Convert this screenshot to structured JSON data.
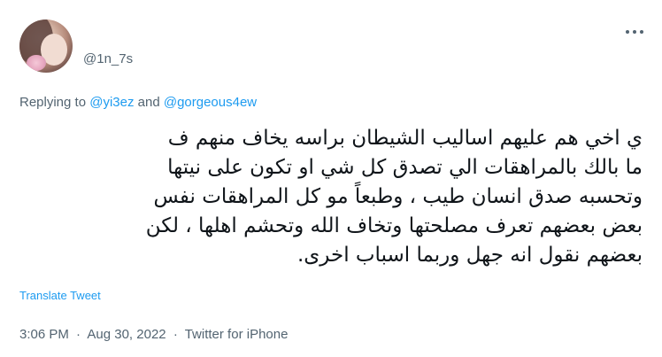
{
  "author": {
    "handle": "@1n_7s"
  },
  "reply_context": {
    "prefix": "Replying to",
    "user1": "@yi3ez",
    "conjunction": "and",
    "user2": "@gorgeous4ew"
  },
  "tweet": {
    "lines": [
      "ي اخي هم عليهم اساليب الشيطان براسه يخاف منهم ف",
      "ما بالك بالمراهقات الي تصدق كل شي او تكون على نيتها",
      "وتحسبه صدق انسان طيب ، وطبعاً مو كل المراهقات نفس",
      "بعض بعضهم تعرف مصلحتها وتخاف الله وتحشم اهلها ، لكن",
      "بعضهم نقول انه جهل وربما اسباب اخرى."
    ],
    "translate_label": "Translate Tweet"
  },
  "meta": {
    "time": "3:06 PM",
    "separator": "·",
    "date": "Aug 30, 2022",
    "source": "Twitter for iPhone"
  },
  "colors": {
    "link": "#1d9bf0",
    "secondary_text": "#536471",
    "primary_text": "#0f1419"
  },
  "icons": {
    "more": "more-horizontal-icon"
  }
}
